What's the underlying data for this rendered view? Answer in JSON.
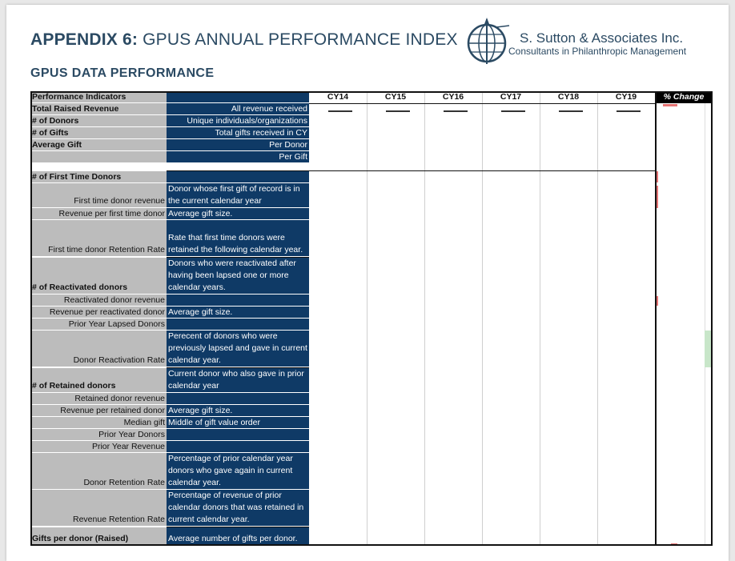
{
  "header": {
    "title_bold": "APPENDIX 6:",
    "title_rest": " GPUS ANNUAL PERFORMANCE INDEX",
    "subtitle": "GPUS DATA PERFORMANCE"
  },
  "brand": {
    "name": "S. Sutton & Associates Inc.",
    "tagline": "Consultants in Philanthropic Management",
    "logo_icon": "globe-compass-icon",
    "color": "#2b4a63"
  },
  "table": {
    "header_label": "Performance Indicators",
    "year_columns": [
      "CY14",
      "CY15",
      "CY16",
      "CY17",
      "CY18",
      "CY19"
    ],
    "change_column": "% Change",
    "rows": [
      {
        "label": "Total Raised Revenue",
        "desc": "All revenue received"
      },
      {
        "label": "# of Donors",
        "desc": "Unique individuals/organizations"
      },
      {
        "label": "# of Gifts",
        "desc": "Total gifts received in CY"
      },
      {
        "label": "Average Gift",
        "desc": "Per Donor"
      },
      {
        "label": "",
        "desc": "Per Gift"
      },
      {
        "label": "# of First Time Donors",
        "desc": ""
      },
      {
        "label": "First time donor revenue",
        "desc": "Donor whose first  gift of record is in the current calendar year"
      },
      {
        "label": "Revenue per first time donor",
        "desc": "Average gift size."
      },
      {
        "label": "First time donor Retention Rate",
        "desc": "Rate that first time donors were retained the following calendar year."
      },
      {
        "label": "# of Reactivated donors",
        "desc": "Donors who were reactivated after having been lapsed one or more calendar years."
      },
      {
        "label": "Reactivated donor revenue",
        "desc": ""
      },
      {
        "label": "Revenue per reactivated donor",
        "desc": "Average gift size."
      },
      {
        "label": "Prior Year Lapsed Donors",
        "desc": ""
      },
      {
        "label": "Donor Reactivation Rate",
        "desc": "Perecent of donors who were previously lapsed and gave in current calendar year."
      },
      {
        "label": "# of Retained donors",
        "desc": "Current donor who also gave in prior calendar year"
      },
      {
        "label": "Retained donor revenue",
        "desc": ""
      },
      {
        "label": "Revenue per retained donor",
        "desc": "Average gift size."
      },
      {
        "label": "Median gift",
        "desc": "Middle of gift value order"
      },
      {
        "label": "Prior Year Donors",
        "desc": ""
      },
      {
        "label": "Prior Year Revenue",
        "desc": ""
      },
      {
        "label": "Donor Retention Rate",
        "desc": "Percentage of prior calendar year donors who gave again in current calendar year."
      },
      {
        "label": "Revenue Retention Rate",
        "desc": "Percentage of revenue of prior calendar donors that was retained in current calendar year."
      },
      {
        "label": "Gifts per donor (Raised)",
        "desc": "Average number of gifts per donor."
      }
    ]
  },
  "colors": {
    "label_bg": "#bcbcbc",
    "desc_bg": "#0f3a66",
    "change_bg": "#000000"
  }
}
